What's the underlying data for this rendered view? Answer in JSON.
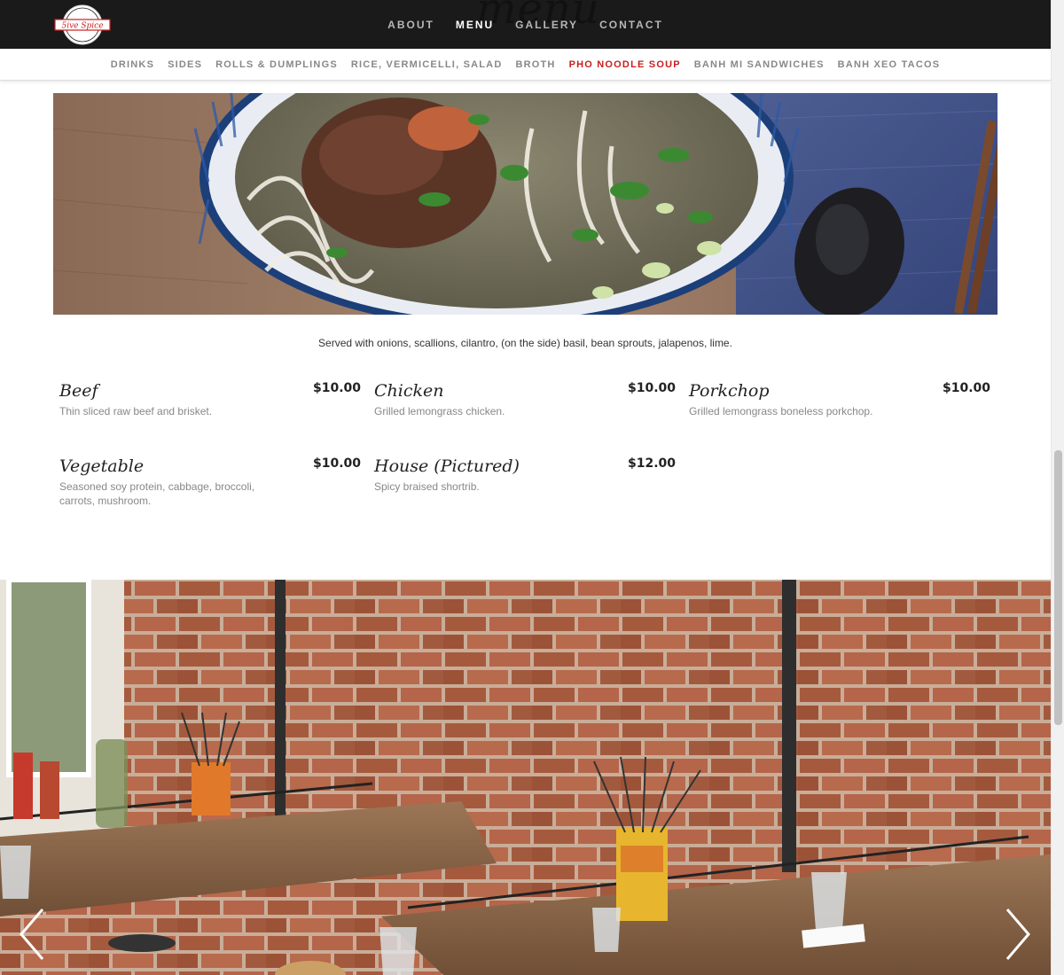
{
  "logo": {
    "text": "5ive Spice"
  },
  "ghost_title": "menu",
  "main_nav": [
    {
      "label": "ABOUT",
      "active": false
    },
    {
      "label": "MENU",
      "active": true
    },
    {
      "label": "GALLERY",
      "active": false
    },
    {
      "label": "CONTACT",
      "active": false
    }
  ],
  "sub_nav": [
    {
      "label": "DRINKS",
      "active": false
    },
    {
      "label": "SIDES",
      "active": false
    },
    {
      "label": "ROLLS & DUMPLINGS",
      "active": false
    },
    {
      "label": "RICE, VERMICELLI, SALAD",
      "active": false
    },
    {
      "label": "BROTH",
      "active": false
    },
    {
      "label": "PHO NOODLE SOUP",
      "active": true
    },
    {
      "label": "BANH MI SANDWICHES",
      "active": false
    },
    {
      "label": "BANH XEO TACOS",
      "active": false
    }
  ],
  "section": {
    "note": "Served with onions, scallions, cilantro, (on the side) basil, bean sprouts, jalapenos, lime."
  },
  "items": [
    {
      "name": "Beef",
      "price": "$10.00",
      "desc": "Thin sliced raw beef and brisket."
    },
    {
      "name": "Chicken",
      "price": "$10.00",
      "desc": "Grilled lemongrass chicken."
    },
    {
      "name": "Porkchop",
      "price": "$10.00",
      "desc": "Grilled lemongrass boneless porkchop."
    },
    {
      "name": "Vegetable",
      "price": "$10.00",
      "desc": "Seasoned soy protein, cabbage, broccoli, carrots, mushroom."
    },
    {
      "name": "House (Pictured)",
      "price": "$12.00",
      "desc": "Spicy braised shortrib."
    }
  ],
  "colors": {
    "active_sub": "#c81e1e",
    "topbar": "#1a1a1a"
  }
}
